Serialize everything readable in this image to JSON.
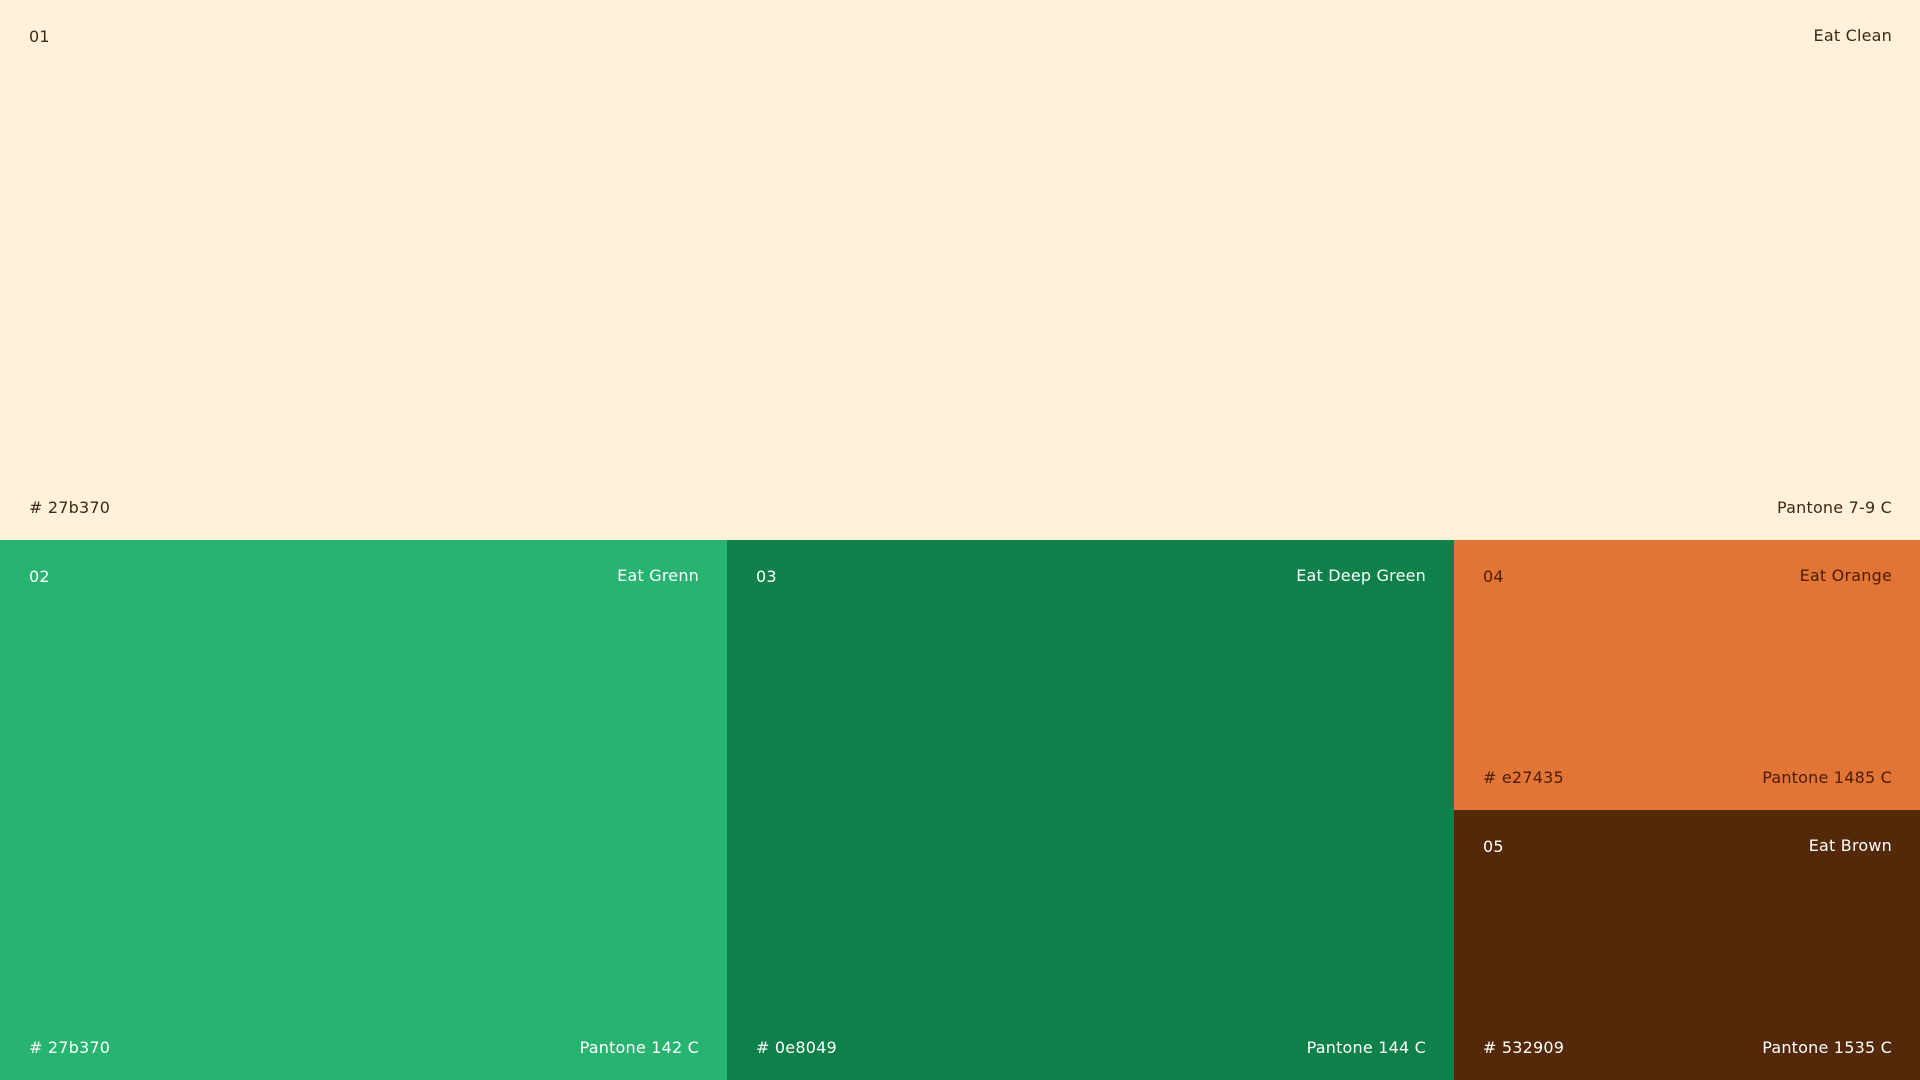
{
  "swatches": [
    {
      "index": "01",
      "name": "Eat Clean",
      "hex": "# 27b370",
      "pantone": "Pantone 7-9 C",
      "background": "#FFF2D8",
      "text_color": "#3A2A1A"
    },
    {
      "index": "02",
      "name": "Eat Grenn",
      "hex": "# 27b370",
      "pantone": "Pantone 142 C",
      "background": "#27B370",
      "text_color": "#FFFFFF"
    },
    {
      "index": "03",
      "name": "Eat Deep Green",
      "hex": "# 0e8049",
      "pantone": "Pantone 144 C",
      "background": "#0E8049",
      "text_color": "#FFFFFF"
    },
    {
      "index": "04",
      "name": "Eat Orange",
      "hex": "# e27435",
      "pantone": "Pantone 1485 C",
      "background": "#E27435",
      "text_color": "#4A1E05"
    },
    {
      "index": "05",
      "name": "Eat Brown",
      "hex": "# 532909",
      "pantone": "Pantone 1535 C",
      "background": "#532909",
      "text_color": "#FFFFFF"
    }
  ]
}
